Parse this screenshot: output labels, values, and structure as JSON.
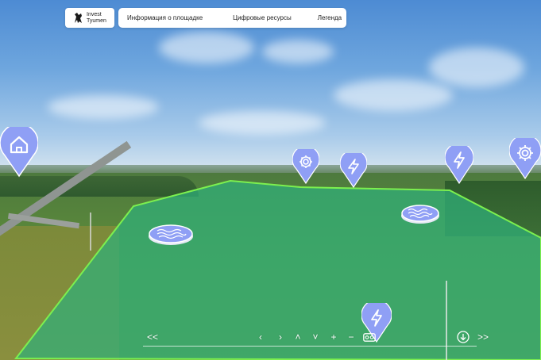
{
  "header": {
    "logo_line1": "Invest",
    "logo_line2": "Tyumen"
  },
  "menu": {
    "items": [
      {
        "label": "Информация о площадке"
      },
      {
        "label": "Цифровые ресурсы"
      },
      {
        "label": "Легенда"
      }
    ]
  },
  "hotspots": {
    "home_pin_icon": "house-icon",
    "settings_pin_icon": "gear-icon",
    "lightning_pin_icon": "lightning-icon",
    "water_badge_icon": "water-waves-icon"
  },
  "controls": {
    "prev_scene": "<<",
    "rotate_left": "‹",
    "rotate_right": "›",
    "rotate_up": "˄",
    "rotate_down": "˅",
    "zoom_in": "+",
    "zoom_out": "−",
    "next_scene": ">>"
  },
  "colors": {
    "pin_fill": "#8f9ff5",
    "pin_icon": "#ffffff",
    "plot_overlay": "#2fb07a",
    "plot_border": "#7cf04f"
  }
}
